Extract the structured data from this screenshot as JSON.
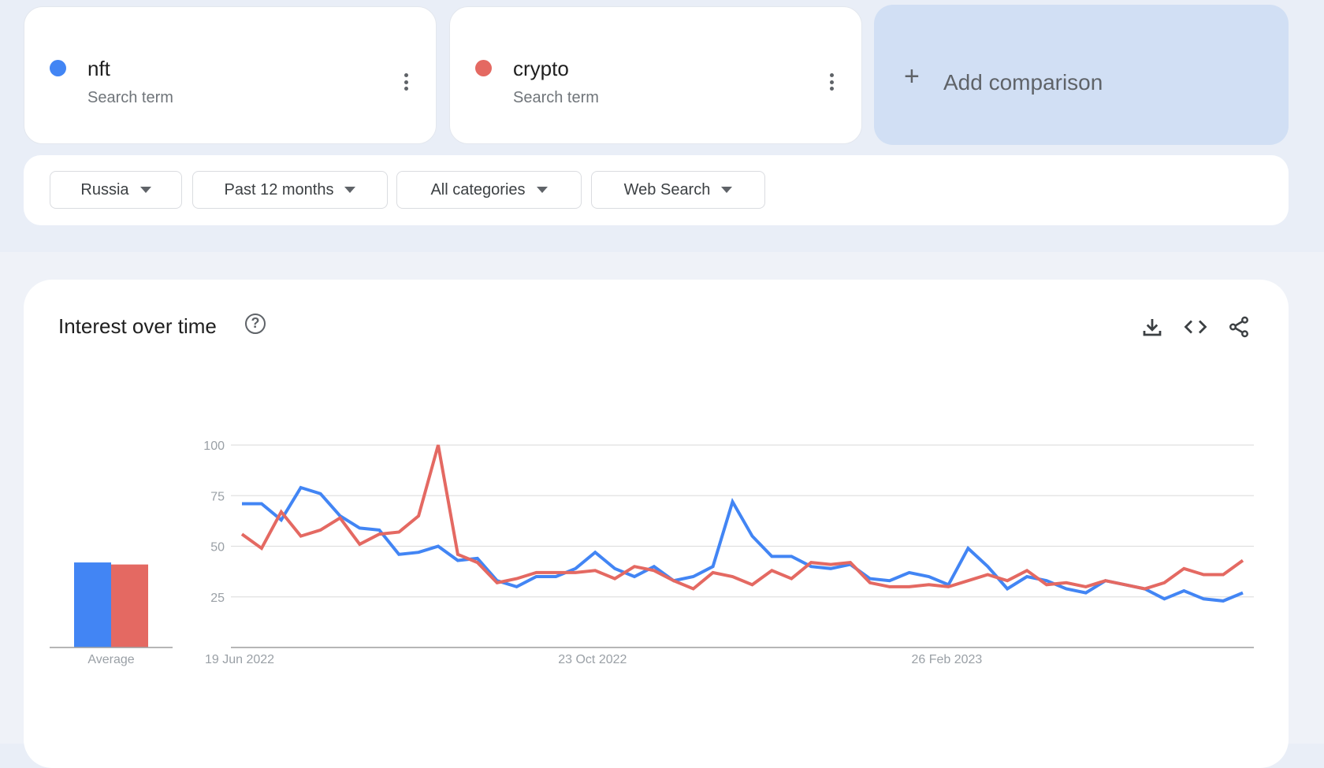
{
  "terms": [
    {
      "name": "nft",
      "subtitle": "Search term",
      "color": "#4285f4"
    },
    {
      "name": "crypto",
      "subtitle": "Search term",
      "color": "#e46962"
    }
  ],
  "add_comparison": {
    "label": "Add comparison",
    "icon": "plus-icon"
  },
  "filters": [
    {
      "label": "Russia"
    },
    {
      "label": "Past 12 months"
    },
    {
      "label": "All categories"
    },
    {
      "label": "Web Search"
    }
  ],
  "panel": {
    "title": "Interest over time",
    "help_icon": "?",
    "tools": [
      "download-icon",
      "embed-code-icon",
      "share-icon"
    ]
  },
  "chart_data": {
    "type": "line",
    "title": "Interest over time",
    "xlabel": "",
    "ylabel": "",
    "ylim": [
      0,
      100
    ],
    "yticks": [
      25,
      50,
      75,
      100
    ],
    "grid": true,
    "x_tick_labels": [
      {
        "index": 0,
        "label": "19 Jun 2022"
      },
      {
        "index": 18,
        "label": "23 Oct 2022"
      },
      {
        "index": 36,
        "label": "26 Feb 2023"
      }
    ],
    "series": [
      {
        "name": "nft",
        "color": "#4285f4",
        "values": [
          71,
          71,
          63,
          79,
          76,
          65,
          59,
          58,
          46,
          47,
          50,
          43,
          44,
          33,
          30,
          35,
          35,
          39,
          47,
          39,
          35,
          40,
          33,
          35,
          40,
          72,
          55,
          45,
          45,
          40,
          39,
          41,
          34,
          33,
          37,
          35,
          31,
          49,
          40,
          29,
          35,
          33,
          29,
          27,
          33,
          31,
          29,
          24,
          28,
          24,
          23,
          27
        ]
      },
      {
        "name": "crypto",
        "color": "#e46962",
        "values": [
          56,
          49,
          67,
          55,
          58,
          64,
          51,
          56,
          57,
          65,
          100,
          46,
          42,
          32,
          34,
          37,
          37,
          37,
          38,
          34,
          40,
          38,
          33,
          29,
          37,
          35,
          31,
          38,
          34,
          42,
          41,
          42,
          32,
          30,
          30,
          31,
          30,
          33,
          36,
          33,
          38,
          31,
          32,
          30,
          33,
          31,
          29,
          32,
          39,
          36,
          36,
          43
        ]
      }
    ],
    "averages": {
      "label": "Average",
      "values": [
        {
          "name": "nft",
          "value": 42
        },
        {
          "name": "crypto",
          "value": 41
        }
      ]
    }
  }
}
